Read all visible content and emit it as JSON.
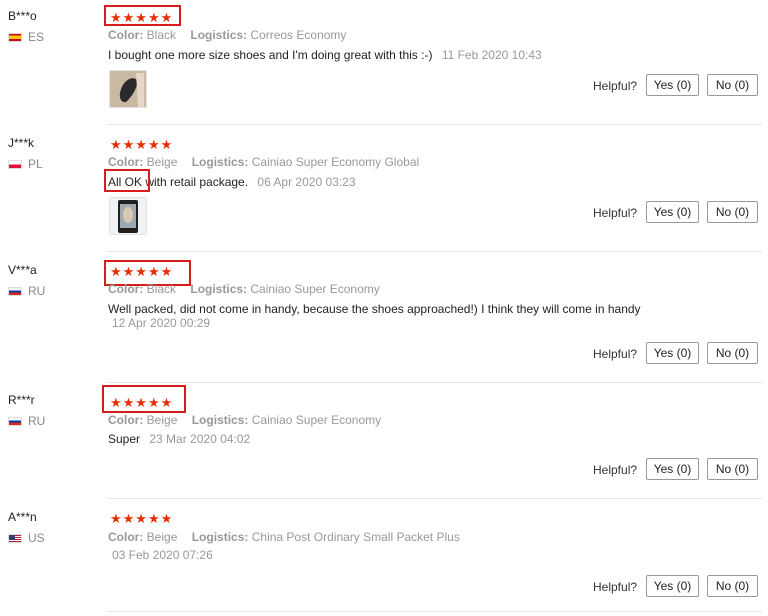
{
  "helpful_label": "Helpful?",
  "star_icon": "star-icon",
  "accent_color": "#e62e04",
  "highlight_color": "#d61c1c",
  "reviews": [
    {
      "user": "B***o",
      "country": "ES",
      "stars": 5,
      "color_label": "Color:",
      "color": "Black",
      "logistics_label": "Logistics:",
      "logistics": "Correos Economy",
      "text": "I bought one more size shoes and I'm doing great with this :-)",
      "date": "11 Feb 2020 10:43",
      "yes": "Yes (0)",
      "no": "No (0)"
    },
    {
      "user": "J***k",
      "country": "PL",
      "stars": 5,
      "color_label": "Color:",
      "color": "Beige",
      "logistics_label": "Logistics:",
      "logistics": "Cainiao Super Economy Global",
      "text": "All OK with retail package.",
      "date": "06 Apr 2020 03:23",
      "yes": "Yes (0)",
      "no": "No (0)"
    },
    {
      "user": "V***a",
      "country": "RU",
      "stars": 5,
      "color_label": "Color:",
      "color": "Black",
      "logistics_label": "Logistics:",
      "logistics": "Cainiao Super Economy",
      "text": "Well packed, did not come in handy, because the shoes approached!) I think they will come in handy",
      "date": "12 Apr 2020 00:29",
      "yes": "Yes (0)",
      "no": "No (0)"
    },
    {
      "user": "R***r",
      "country": "RU",
      "stars": 5,
      "color_label": "Color:",
      "color": "Beige",
      "logistics_label": "Logistics:",
      "logistics": "Cainiao Super Economy",
      "text": "Super",
      "date": "23 Mar 2020 04:02",
      "yes": "Yes (0)",
      "no": "No (0)"
    },
    {
      "user": "A***n",
      "country": "US",
      "stars": 5,
      "color_label": "Color:",
      "color": "Beige",
      "logistics_label": "Logistics:",
      "logistics": "China Post Ordinary Small Packet Plus",
      "text": "",
      "date": "03 Feb 2020 07:26",
      "yes": "Yes (0)",
      "no": "No (0)"
    }
  ]
}
